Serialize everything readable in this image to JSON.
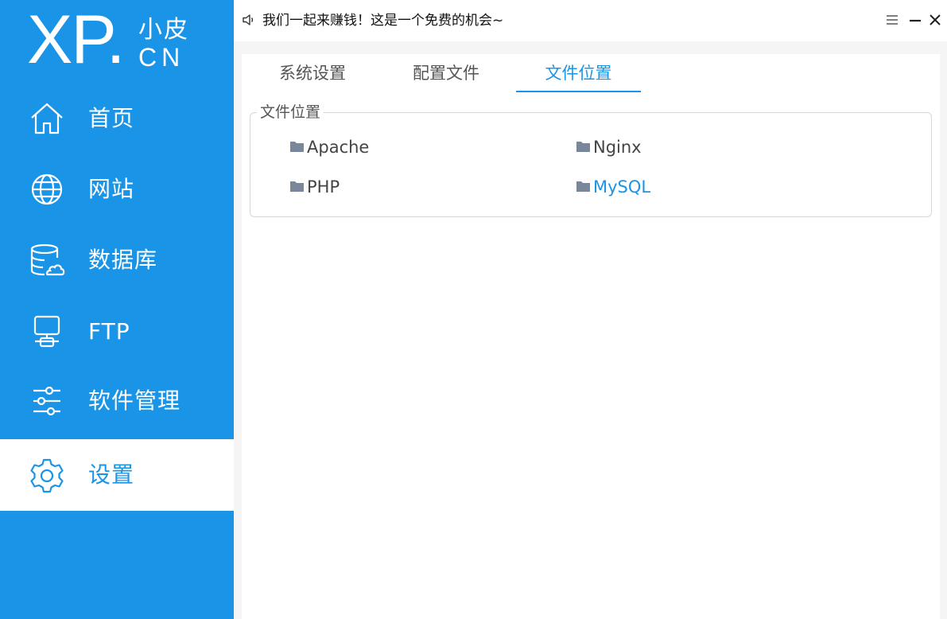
{
  "logo": {
    "main": "XP",
    "dot": ".",
    "cn_top": "小皮",
    "cn_bottom": "CN"
  },
  "sidebar": {
    "items": [
      {
        "label": "首页",
        "icon": "home-icon"
      },
      {
        "label": "网站",
        "icon": "globe-icon"
      },
      {
        "label": "数据库",
        "icon": "database-icon"
      },
      {
        "label": "FTP",
        "icon": "server-icon"
      },
      {
        "label": "软件管理",
        "icon": "sliders-icon"
      },
      {
        "label": "设置",
        "icon": "gear-icon",
        "active": true
      }
    ]
  },
  "topbar": {
    "notice": "我们一起来赚钱！这是一个免费的机会~",
    "icons": [
      "speaker-icon",
      "menu-icon",
      "minimize-icon",
      "close-icon"
    ]
  },
  "tabs": [
    {
      "label": "系统设置"
    },
    {
      "label": "配置文件"
    },
    {
      "label": "文件位置",
      "active": true
    }
  ],
  "file_locations": {
    "legend": "文件位置",
    "items": [
      {
        "label": "Apache"
      },
      {
        "label": "Nginx"
      },
      {
        "label": "PHP"
      },
      {
        "label": "MySQL",
        "highlighted": true
      }
    ]
  },
  "colors": {
    "accent": "#1a94e6",
    "sidebar_bg": "#1a94e6",
    "folder": "#7a8699",
    "text": "#444444"
  }
}
